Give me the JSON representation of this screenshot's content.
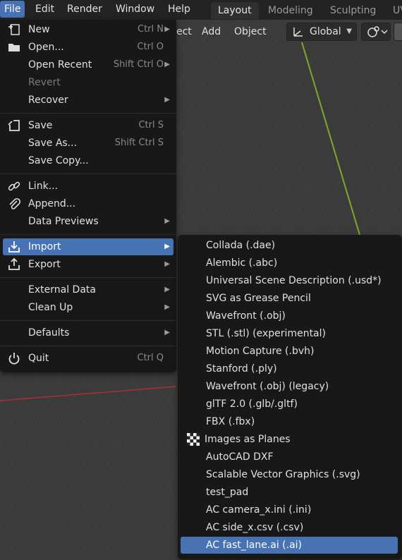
{
  "topbar": {
    "menus": [
      "File",
      "Edit",
      "Render",
      "Window",
      "Help"
    ],
    "workspaces": [
      "Layout",
      "Modeling",
      "Sculpting",
      "UV"
    ]
  },
  "header": {
    "select_partial": "ect",
    "add": "Add",
    "object": "Object",
    "orientation": "Global"
  },
  "file_menu": {
    "items": [
      {
        "label": "New",
        "shortcut": "Ctrl N",
        "icon": "new-file-icon",
        "submenu": true
      },
      {
        "label": "Open...",
        "shortcut": "Ctrl O",
        "icon": "folder-icon"
      },
      {
        "label": "Open Recent",
        "shortcut": "Shift Ctrl O",
        "submenu": true
      },
      {
        "label": "Revert",
        "disabled": true
      },
      {
        "label": "Recover",
        "submenu": true
      },
      {
        "label": "Save",
        "shortcut": "Ctrl S",
        "icon": "save-icon"
      },
      {
        "label": "Save As...",
        "shortcut": "Shift Ctrl S"
      },
      {
        "label": "Save Copy..."
      },
      {
        "label": "Link...",
        "icon": "link-icon"
      },
      {
        "label": "Append...",
        "icon": "append-icon"
      },
      {
        "label": "Data Previews",
        "submenu": true
      },
      {
        "label": "Import",
        "icon": "import-icon",
        "submenu": true,
        "highlighted": true
      },
      {
        "label": "Export",
        "icon": "export-icon",
        "submenu": true
      },
      {
        "label": "External Data",
        "submenu": true
      },
      {
        "label": "Clean Up",
        "submenu": true
      },
      {
        "label": "Defaults",
        "submenu": true
      },
      {
        "label": "Quit",
        "shortcut": "Ctrl Q",
        "icon": "power-icon"
      }
    ]
  },
  "import_menu": {
    "items": [
      {
        "label": "Collada (.dae)"
      },
      {
        "label": "Alembic (.abc)"
      },
      {
        "label": "Universal Scene Description (.usd*)"
      },
      {
        "label": "SVG as Grease Pencil"
      },
      {
        "label": "Wavefront (.obj)"
      },
      {
        "label": "STL (.stl) (experimental)"
      },
      {
        "label": "Motion Capture (.bvh)"
      },
      {
        "label": "Stanford (.ply)"
      },
      {
        "label": "Wavefront (.obj) (legacy)"
      },
      {
        "label": "glTF 2.0 (.glb/.gltf)"
      },
      {
        "label": "FBX (.fbx)"
      },
      {
        "label": "Images as Planes",
        "icon": "checker-icon"
      },
      {
        "label": "AutoCAD DXF"
      },
      {
        "label": "Scalable Vector Graphics (.svg)"
      },
      {
        "label": "test_pad"
      },
      {
        "label": "AC camera_x.ini (.ini)"
      },
      {
        "label": "AC side_x.csv (.csv)"
      },
      {
        "label": "AC fast_lane.ai (.ai)",
        "highlighted": true
      }
    ]
  },
  "colors": {
    "accent": "#4772b3",
    "menu_bg": "#181818",
    "y_axis": "#7fa82a",
    "x_axis": "#a8323a"
  }
}
